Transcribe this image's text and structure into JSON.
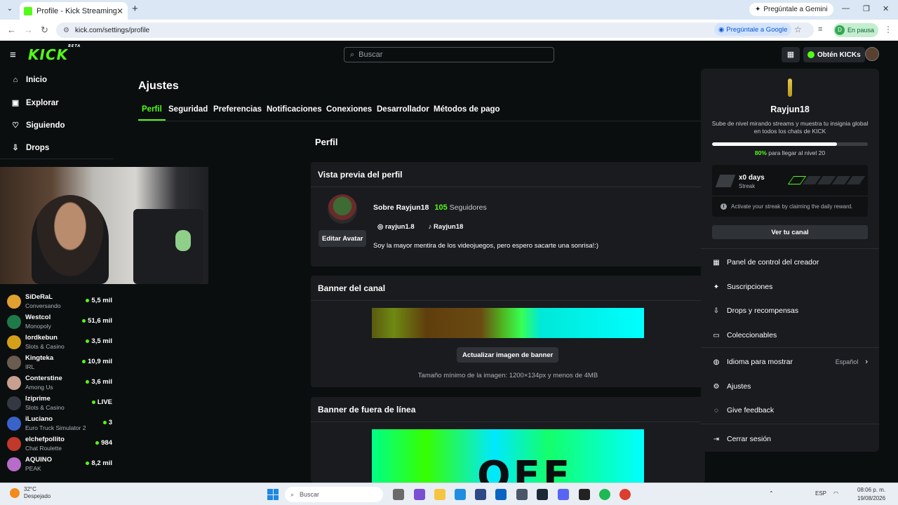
{
  "browser": {
    "tab_title": "Profile - Kick Streaming",
    "gemini_label": "Pregúntale a Gemini",
    "url": "kick.com/settings/profile",
    "ask_google_label": "Pregúntale a Google",
    "profile_status": "En pausa",
    "profile_initial": "D"
  },
  "header": {
    "logo": "KICK",
    "logo_tag": "BETA",
    "search_placeholder": "Buscar",
    "kicks_label": "Obtén KICKs"
  },
  "sidebar": {
    "nav": [
      {
        "label": "Inicio",
        "icon": "home-icon"
      },
      {
        "label": "Explorar",
        "icon": "compass-icon"
      },
      {
        "label": "Siguiendo",
        "icon": "heart-icon"
      },
      {
        "label": "Drops",
        "icon": "drops-icon"
      }
    ],
    "recommended": [
      {
        "name": "SiDeRaL",
        "category": "Conversando",
        "viewers": "5,5 mil",
        "color": "#e0a030"
      },
      {
        "name": "Westcol",
        "category": "Monopoly",
        "viewers": "51,6 mil",
        "color": "#1f7a4a"
      },
      {
        "name": "lordkebun",
        "category": "Slots & Casino",
        "viewers": "3,5 mil",
        "color": "#d4a017"
      },
      {
        "name": "Kingteka",
        "category": "IRL",
        "viewers": "10,9 mil",
        "color": "#6b5c50"
      },
      {
        "name": "Conterstine",
        "category": "Among Us",
        "viewers": "3,6 mil",
        "color": "#c8a090"
      },
      {
        "name": "Iziprime",
        "category": "Slots & Casino",
        "viewers": "LIVE",
        "color": "#333842"
      },
      {
        "name": "iLuciano",
        "category": "Euro Truck Simulator 2",
        "viewers": "3",
        "color": "#3a63c9"
      },
      {
        "name": "elchefpollito",
        "category": "Chat Roulette",
        "viewers": "984",
        "color": "#c0392b"
      },
      {
        "name": "AQUINO",
        "category": "PEAK",
        "viewers": "8,2 mil",
        "color": "#b86cc9"
      }
    ]
  },
  "settings": {
    "title": "Ajustes",
    "tabs": [
      "Perfil",
      "Seguridad",
      "Preferencias",
      "Notificaciones",
      "Conexiones",
      "Desarrollador",
      "Métodos de pago"
    ],
    "section_title": "Perfil",
    "preview": {
      "heading": "Vista previa del perfil",
      "edit_avatar": "Editar Avatar",
      "about": "Sobre Rayjun18",
      "followers_count": "105",
      "followers_label": "Seguidores",
      "instagram": "rayjun1.8",
      "tiktok": "Rayjun18",
      "bio": "Soy la mayor mentira de los videojuegos, pero espero sacarte una sonrisa!:)"
    },
    "banner": {
      "heading": "Banner del canal",
      "button": "Actualizar imagen de banner",
      "hint": "Tamaño mínimo de la imagen: 1200×134px y menos de 4MB"
    },
    "offline_banner": {
      "heading": "Banner de fuera de línea",
      "overlay_text": "OFF"
    }
  },
  "dropdown": {
    "username": "Rayjun18",
    "description": "Sube de nivel mirando streams y muestra tu insignia global en todos los chats de KICK",
    "progress_percent": 80,
    "progress_pct_label": "80%",
    "progress_rest": "para llegar al nivel 20",
    "streak_days": "x0 days",
    "streak_label": "Streak",
    "streak_info": "Activate your streak by claiming the daily reward.",
    "view_channel": "Ver tu canal",
    "menu": [
      {
        "label": "Panel de control del creador",
        "icon": "dashboard-icon"
      },
      {
        "label": "Suscripciones",
        "icon": "sparkle-icon"
      },
      {
        "label": "Drops y recompensas",
        "icon": "drops-icon"
      },
      {
        "label": "Coleccionables",
        "icon": "collectibles-icon"
      },
      {
        "label": "Idioma para mostrar",
        "icon": "globe-icon",
        "value": "Español"
      },
      {
        "label": "Ajustes",
        "icon": "gear-icon"
      },
      {
        "label": "Give feedback",
        "icon": "feedback-icon"
      },
      {
        "label": "Cerrar sesión",
        "icon": "logout-icon"
      }
    ]
  },
  "taskbar": {
    "temperature": "32°C",
    "weather": "Despejado",
    "search_placeholder": "Buscar",
    "lang": "ESP",
    "time": "08:06 p. m.",
    "date": "19/08/2026"
  }
}
